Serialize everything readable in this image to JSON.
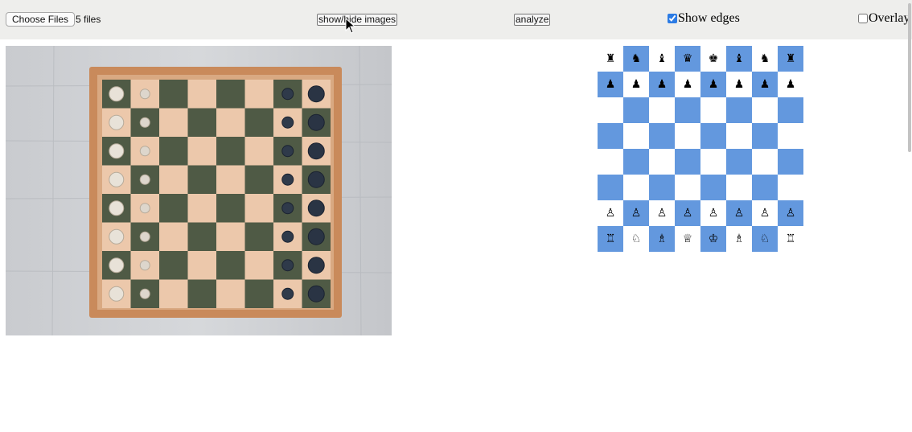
{
  "toolbar": {
    "file_button_label": "Choose Files",
    "file_count": "5 files",
    "toggle_images_label": "show/hide images",
    "analyze_label": "analyze",
    "show_edges_label": "Show edges",
    "show_edges_checked": true,
    "overlay_label": "Overlay",
    "overlay_checked": false
  },
  "colors": {
    "toolbar_bg": "#eeeeec",
    "board_dark": "#6398de",
    "board_light": "#ffffff",
    "checkbox_accent": "#2b7be4"
  },
  "board": {
    "ranks": [
      [
        "♜",
        "♞",
        "♝",
        "♛",
        "♚",
        "♝",
        "♞",
        "♜"
      ],
      [
        "♟",
        "♟",
        "♟",
        "♟",
        "♟",
        "♟",
        "♟",
        "♟"
      ],
      [
        "",
        "",
        "",
        "",
        "",
        "",
        "",
        ""
      ],
      [
        "",
        "",
        "",
        "",
        "",
        "",
        "",
        ""
      ],
      [
        "",
        "",
        "",
        "",
        "",
        "",
        "",
        ""
      ],
      [
        "",
        "",
        "",
        "",
        "",
        "",
        "",
        ""
      ],
      [
        "♙",
        "♙",
        "♙",
        "♙",
        "♙",
        "♙",
        "♙",
        "♙"
      ],
      [
        "♖",
        "♘",
        "♗",
        "♕",
        "♔",
        "♗",
        "♘",
        "♖"
      ]
    ],
    "top_left_color": "light"
  }
}
